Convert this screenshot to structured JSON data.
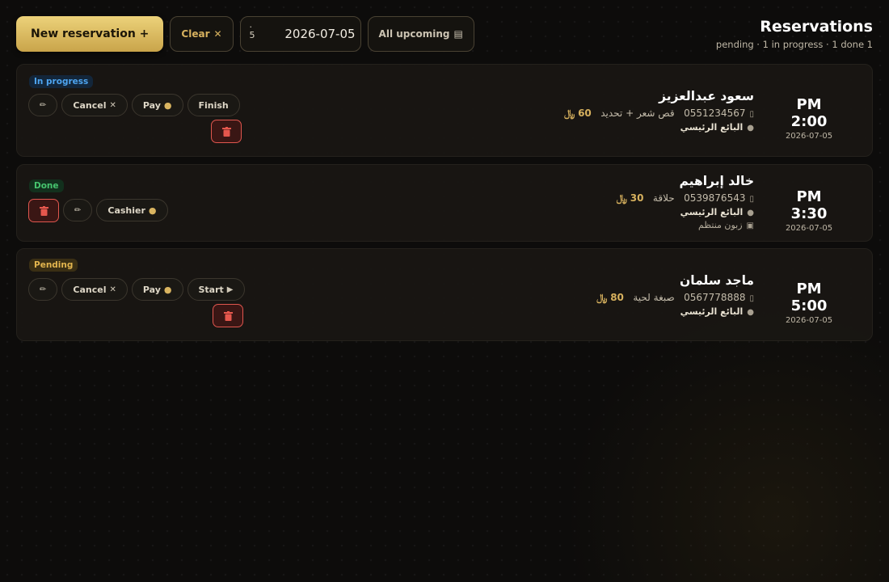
{
  "toolbar": {
    "new_label": "New reservation +",
    "clear_label": "Clear",
    "date_prefix_top": "·",
    "date_prefix_bottom": "5",
    "date_value": "2026-07-05",
    "upcoming_label": "All upcoming"
  },
  "header": {
    "title": "Reservations",
    "stats": "pending · 1 in progress · 1 done 1"
  },
  "reservations": [
    {
      "status": "In progress",
      "name": "سعود عبدالعزيز",
      "phone": "0551234567",
      "service": "قص شعر + تحديد",
      "price": "60",
      "currency": "﷼",
      "seller": "البائع الرئيسي",
      "time": "PM 2:00",
      "date": "2026-07-05",
      "actions": [
        "Cancel",
        "Pay",
        "Finish"
      ]
    },
    {
      "status": "Done",
      "name": "خالد إبراهيم",
      "phone": "0539876543",
      "service": "حلاقة",
      "price": "30",
      "currency": "﷼",
      "seller": "البائع الرئيسي",
      "note": "زبون منتظم",
      "time": "PM 3:30",
      "date": "2026-07-05",
      "actions": [
        "Cashier"
      ]
    },
    {
      "status": "Pending",
      "name": "ماجد سلمان",
      "phone": "0567778888",
      "service": "صبغة لحية",
      "price": "80",
      "currency": "﷼",
      "seller": "البائع الرئيسي",
      "time": "PM 5:00",
      "date": "2026-07-05",
      "actions": [
        "Cancel",
        "Pay",
        "Start"
      ]
    }
  ]
}
